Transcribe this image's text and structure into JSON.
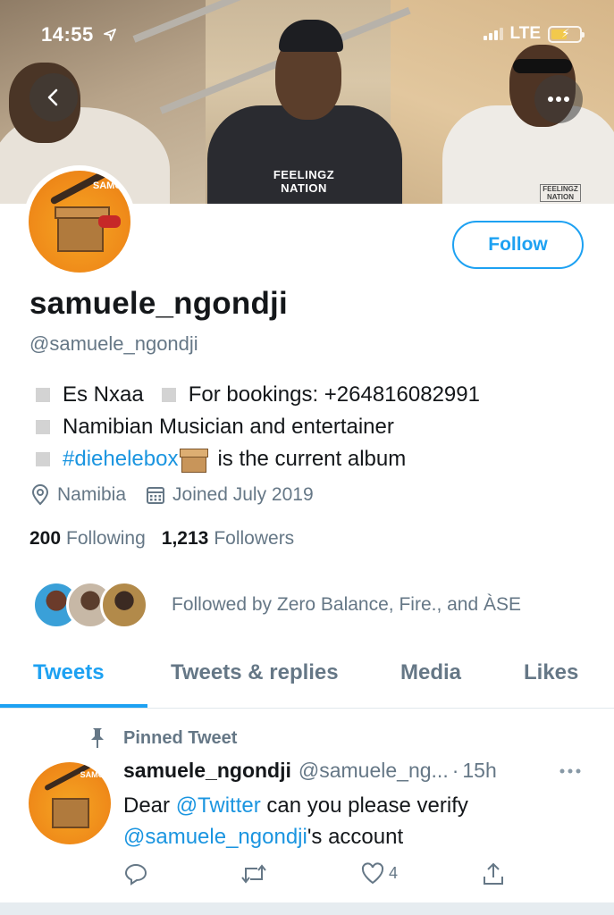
{
  "status_bar": {
    "time": "14:55",
    "network": "LTE"
  },
  "profile": {
    "display_name": "samuele_ngondji",
    "handle": "@samuele_ngondji",
    "follow_label": "Follow",
    "bio": {
      "line1_a": "Es Nxaa",
      "line1_b": "For bookings: +264816082991",
      "line2": "Namibian Musician and entertainer",
      "hashtag": "#diehelebox",
      "line3_rest": "is the current album"
    },
    "location": "Namibia",
    "joined": "Joined July 2019",
    "following_count": "200",
    "following_label": "Following",
    "followers_count": "1,213",
    "followers_label": "Followers",
    "followed_by": "Followed by Zero Balance, Fire., and ÀSE"
  },
  "banner": {
    "shirt_print": "FEELINGZ NATION",
    "small_print": "FEELINGZ NATION"
  },
  "avatar_tag": "SAMO",
  "tabs": [
    {
      "label": "Tweets",
      "active": true
    },
    {
      "label": "Tweets & replies"
    },
    {
      "label": "Media"
    },
    {
      "label": "Likes"
    }
  ],
  "tweet": {
    "pinned_label": "Pinned Tweet",
    "author_name": "samuele_ngondji",
    "author_handle": "@samuele_ng...",
    "separator": "·",
    "time": "15h",
    "text_a": "Dear ",
    "mention1": "@Twitter",
    "text_b": " can you please verify",
    "mention2": "@samuele_ngondji",
    "text_c": "'s account",
    "like_count": "4"
  },
  "colors": {
    "accent": "#1da1f2",
    "secondary_text": "#657786",
    "primary_text": "#14171a"
  },
  "icons": [
    "back-icon",
    "more-icon",
    "location-icon",
    "calendar-icon",
    "pin-icon",
    "reply-icon",
    "retweet-icon",
    "like-icon",
    "share-icon"
  ]
}
